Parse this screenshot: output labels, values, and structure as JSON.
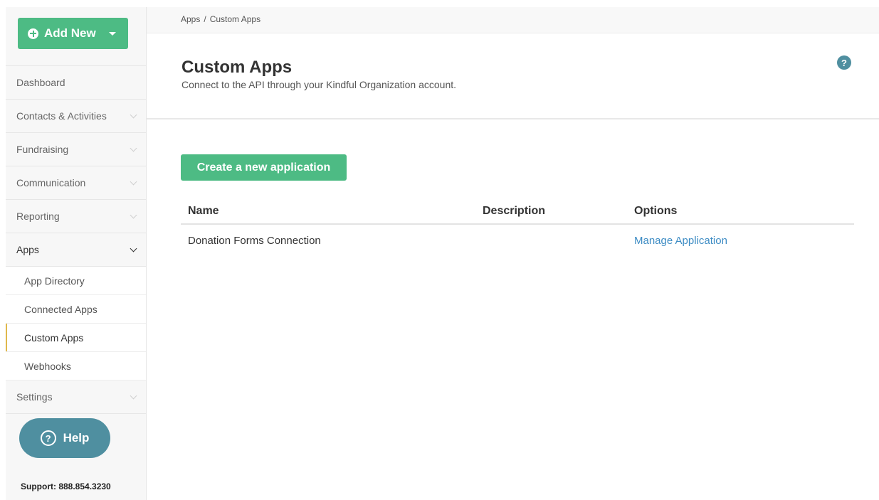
{
  "sidebar": {
    "add_new_label": "Add New",
    "nav": [
      {
        "label": "Dashboard",
        "chevron": false
      },
      {
        "label": "Contacts & Activities",
        "chevron": true
      },
      {
        "label": "Fundraising",
        "chevron": true
      },
      {
        "label": "Communication",
        "chevron": true
      },
      {
        "label": "Reporting",
        "chevron": true
      },
      {
        "label": "Apps",
        "chevron": true,
        "open": true
      }
    ],
    "apps_sub": [
      {
        "label": "App Directory"
      },
      {
        "label": "Connected Apps"
      },
      {
        "label": "Custom Apps",
        "active": true
      },
      {
        "label": "Webhooks"
      }
    ],
    "settings_label": "Settings",
    "help_label": "Help",
    "support_text": "Support: 888.854.3230"
  },
  "breadcrumb": {
    "items": [
      "Apps",
      "Custom Apps"
    ],
    "separator": "/"
  },
  "header": {
    "title": "Custom Apps",
    "subtitle": "Connect to the API through your Kindful Organization account.",
    "help_icon_glyph": "?"
  },
  "create_button_label": "Create a new application",
  "table": {
    "columns": [
      "Name",
      "Description",
      "Options"
    ],
    "rows": [
      {
        "name": "Donation Forms Connection",
        "description": "",
        "option": "Manage Application"
      }
    ]
  },
  "colors": {
    "primary_green": "#4dbb84",
    "help_blue": "#4f8fa0",
    "link_blue": "#3d8cc4",
    "active_marker": "#e0b84c"
  }
}
